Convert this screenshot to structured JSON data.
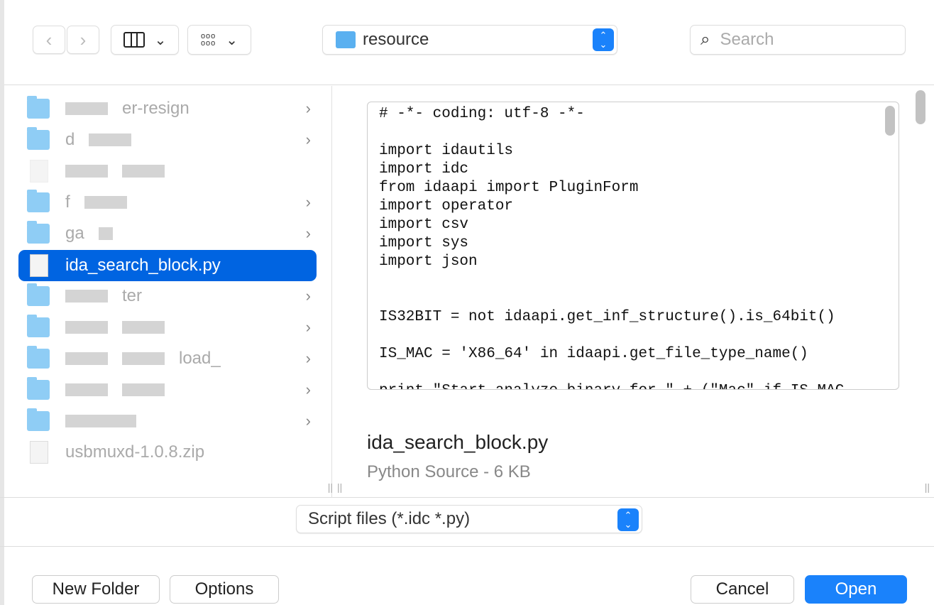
{
  "toolbar": {
    "location": "resource",
    "search_placeholder": "Search"
  },
  "sidebar": {
    "items": [
      {
        "label": "er-resign",
        "type": "folder"
      },
      {
        "label": "d",
        "type": "folder"
      },
      {
        "label": "",
        "type": "file"
      },
      {
        "label": "f",
        "type": "folder"
      },
      {
        "label": "ga",
        "type": "folder"
      },
      {
        "label": "ida_search_block.py",
        "type": "file",
        "selected": true
      },
      {
        "label": "ter",
        "type": "folder"
      },
      {
        "label": "",
        "type": "folder"
      },
      {
        "label": "load_",
        "type": "folder"
      },
      {
        "label": "",
        "type": "folder"
      },
      {
        "label": "",
        "type": "folder"
      },
      {
        "label": "usbmuxd-1.0.8.zip",
        "type": "file"
      }
    ]
  },
  "preview": {
    "code": "# -*- coding: utf-8 -*-\n\nimport idautils\nimport idc\nfrom idaapi import PluginForm\nimport operator\nimport csv\nimport sys\nimport json\n\n\nIS32BIT = not idaapi.get_inf_structure().is_64bit()\n\nIS_MAC = 'X86_64' in idaapi.get_file_type_name()\n\nprint \"Start analyze binary for \" + (\"Mac\" if IS_MAC",
    "filename": "ida_search_block.py",
    "info": "Python Source - 6 KB"
  },
  "filter": {
    "value": "Script files (*.idc *.py)"
  },
  "buttons": {
    "new_folder": "New Folder",
    "options": "Options",
    "cancel": "Cancel",
    "open": "Open"
  },
  "colors": {
    "accent": "#0064e1",
    "primary": "#1a82fb"
  }
}
